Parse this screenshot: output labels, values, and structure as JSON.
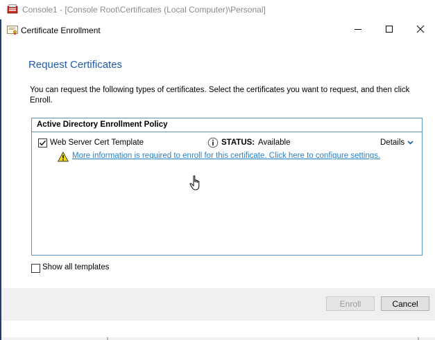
{
  "mmc": {
    "title": "Console1 - [Console Root\\Certificates (Local Computer)\\Personal]",
    "icon": "console-icon"
  },
  "window_controls": {
    "minimize_icon": "minimize-icon",
    "maximize_icon": "maximize-icon",
    "close_icon": "close-icon"
  },
  "dialog": {
    "title": "Certificate Enrollment",
    "icon": "certificate-icon",
    "heading": "Request Certificates",
    "instructions": "You can request the following types of certificates. Select the certificates you want to request, and then click Enroll."
  },
  "policy": {
    "title": "Active Directory Enrollment Policy",
    "certificates": [
      {
        "checked": true,
        "name": "Web Server Cert Template",
        "status_label": "STATUS:",
        "status_value": "Available",
        "details_label": "Details",
        "warning_text": "More information is required to enroll for this certificate. Click here to configure settings."
      }
    ]
  },
  "options": {
    "show_all_templates_label": "Show all templates",
    "show_all_templates_checked": false
  },
  "buttons": {
    "enroll_label": "Enroll",
    "enroll_enabled": false,
    "cancel_label": "Cancel"
  },
  "colors": {
    "heading": "#1e5aa8",
    "link": "#2a7fc1",
    "policy_border": "#5b8fc7",
    "footer_bg": "#f0f0f0"
  }
}
